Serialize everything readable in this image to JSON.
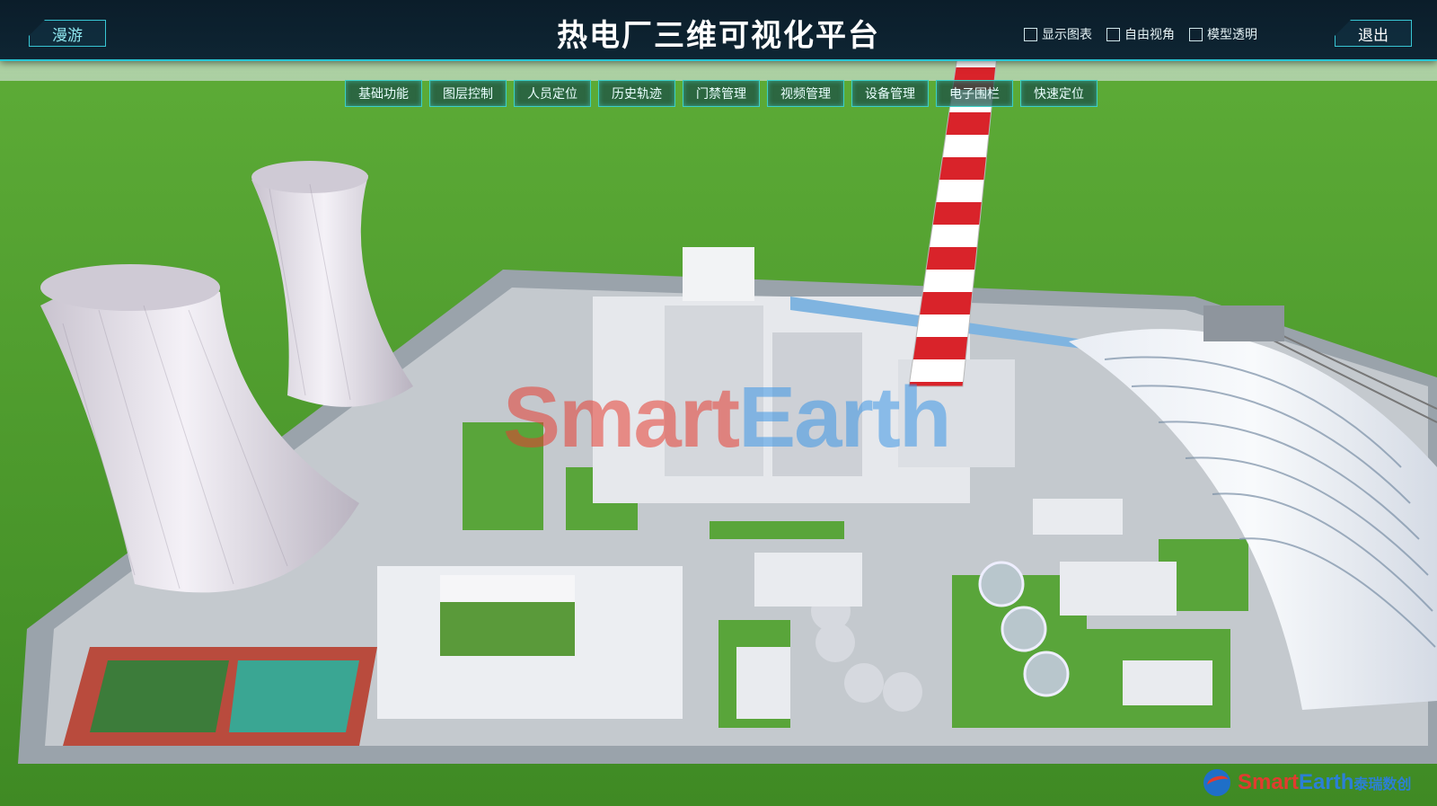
{
  "header": {
    "title": "热电厂三维可视化平台",
    "roam_label": "漫游",
    "exit_label": "退出",
    "options": [
      {
        "label": "显示图表",
        "checked": false
      },
      {
        "label": "自由视角",
        "checked": false
      },
      {
        "label": "模型透明",
        "checked": false
      }
    ]
  },
  "menu": {
    "items": [
      "基础功能",
      "图层控制",
      "人员定位",
      "历史轨迹",
      "门禁管理",
      "视频管理",
      "设备管理",
      "电子围栏",
      "快速定位"
    ]
  },
  "watermark": {
    "part1": "Smart",
    "part2": "Earth"
  },
  "corner_logo": {
    "part1": "Smart",
    "part2": "Earth",
    "suffix": "泰瑞数创"
  },
  "colors": {
    "accent": "#27c7d6",
    "grass": "#58a131",
    "chimney_red": "#d9232a"
  }
}
